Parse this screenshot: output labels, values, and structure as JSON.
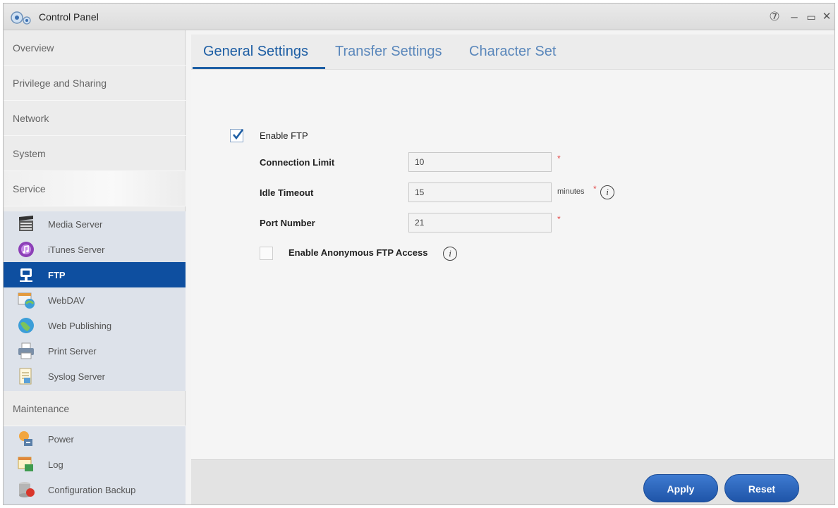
{
  "window": {
    "title": "Control Panel",
    "help_glyph": "⑦",
    "minimize_glyph": "–",
    "maximize_glyph": "▭",
    "close_glyph": "✕"
  },
  "sidebar": {
    "categories": [
      {
        "label": "Overview"
      },
      {
        "label": "Privilege and Sharing"
      },
      {
        "label": "Network"
      },
      {
        "label": "System"
      },
      {
        "label": "Service"
      },
      {
        "label": "Maintenance"
      }
    ],
    "service_items": [
      {
        "label": "Media Server",
        "icon": "media-server-icon"
      },
      {
        "label": "iTunes Server",
        "icon": "itunes-icon"
      },
      {
        "label": "FTP",
        "icon": "ftp-icon"
      },
      {
        "label": "WebDAV",
        "icon": "webdav-icon"
      },
      {
        "label": "Web Publishing",
        "icon": "web-publishing-icon"
      },
      {
        "label": "Print Server",
        "icon": "printer-icon"
      },
      {
        "label": "Syslog Server",
        "icon": "syslog-icon"
      }
    ],
    "maintenance_items": [
      {
        "label": "Power",
        "icon": "power-icon"
      },
      {
        "label": "Log",
        "icon": "log-icon"
      },
      {
        "label": "Configuration Backup",
        "icon": "backup-icon"
      }
    ]
  },
  "tabs": [
    {
      "label": "General Settings"
    },
    {
      "label": "Transfer Settings"
    },
    {
      "label": "Character Set"
    }
  ],
  "form": {
    "enable_ftp": {
      "label": "Enable FTP",
      "checked": true
    },
    "connection_limit": {
      "label": "Connection Limit",
      "value": "10",
      "required_mark": "*"
    },
    "idle_timeout": {
      "label": "Idle Timeout",
      "value": "15",
      "unit": "minutes",
      "required_mark": "*",
      "info_glyph": "i"
    },
    "port_number": {
      "label": "Port Number",
      "value": "21",
      "required_mark": "*"
    },
    "anonymous": {
      "label": "Enable Anonymous FTP Access",
      "checked": false,
      "info_glyph": "i"
    }
  },
  "buttons": {
    "apply": "Apply",
    "reset": "Reset"
  },
  "colors": {
    "accent": "#1d5ea4",
    "selected_item": "#0e4fa0",
    "required": "#e24b4b"
  }
}
